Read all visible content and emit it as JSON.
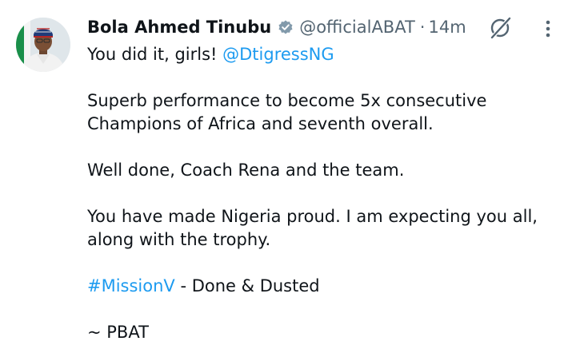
{
  "author": {
    "display_name": "Bola Ahmed Tinubu",
    "handle": "@officialABAT",
    "separator": "·",
    "time": "14m",
    "verified_badge_color": "#829aab"
  },
  "icons": {
    "verified": "verified-badge-icon",
    "grok": "grok-icon",
    "more": "more-options-icon"
  },
  "tweet": {
    "line1_text": "You did it, girls! ",
    "line1_mention": "@DtigressNG",
    "line2": "Superb performance to become 5x consecutive Champions of Africa and seventh overall.",
    "line3": "Well done, Coach Rena and the team.",
    "line4": "You have made Nigeria proud. I am expecting you all, along with the trophy.",
    "line5_hashtag": "#MissionV",
    "line5_text": " - Done & Dusted",
    "line6": "~ PBAT"
  },
  "colors": {
    "link": "#1d9bf0",
    "secondary_text": "#536471",
    "primary_text": "#0f1419"
  }
}
